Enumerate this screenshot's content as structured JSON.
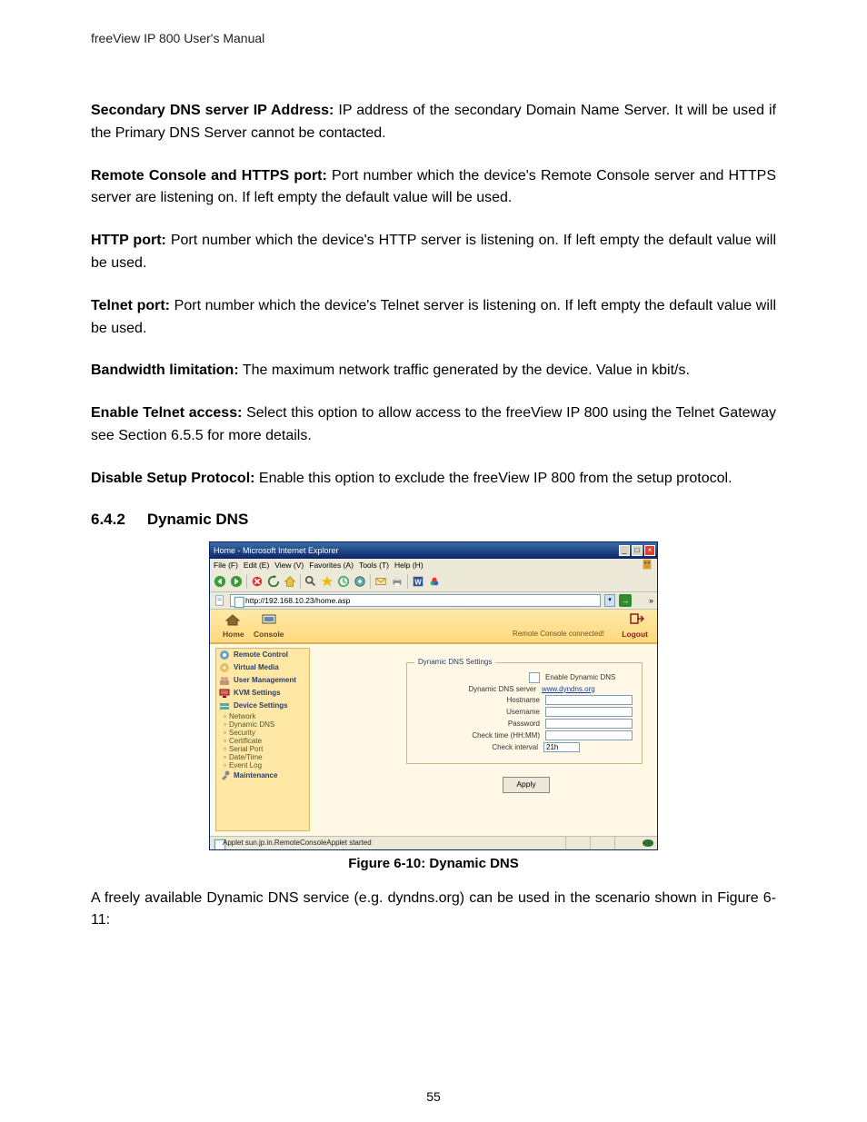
{
  "header_text": "freeView IP 800 User's Manual",
  "page_number": "55",
  "defs": {
    "secdns": {
      "label": "Secondary DNS server IP Address:",
      "text": "  IP address of the secondary Domain Name Server. It will be used if the Primary DNS Server cannot be contacted."
    },
    "rcport": {
      "label": "Remote Console and HTTPS port:",
      "text": " Port number which the device's Remote Console server and HTTPS server are listening on. If left empty the default value will be used."
    },
    "httpport": {
      "label": "HTTP port:",
      "text": " Port number which the device's HTTP server is listening on. If left empty the default value will be used."
    },
    "telnetport": {
      "label": "Telnet port:",
      "text": " Port number which the device's Telnet server is listening on. If left empty the default value will be used."
    },
    "bandwidth": {
      "label": "Bandwidth limitation:",
      "text": " The maximum network traffic generated by the device. Value in kbit/s."
    },
    "telnetacc": {
      "label": "Enable Telnet access:",
      "text": " Select this option to allow access to the freeView IP 800 using the Telnet Gateway see Section 6.5.5 for more details."
    },
    "disablesetup": {
      "label": "Disable Setup Protocol:",
      "text": " Enable this option to exclude the freeView IP 800 from the setup protocol."
    }
  },
  "section": {
    "num": "6.4.2",
    "title": "Dynamic DNS"
  },
  "figure_caption": "Figure 6-10: Dynamic DNS",
  "post_figure_text": "A freely available Dynamic DNS service (e.g. dyndns.org) can be used in the scenario shown in Figure 6-11:",
  "screenshot": {
    "window_title": "Home - Microsoft Internet Explorer",
    "menu": {
      "file": "File",
      "edit": "Edit",
      "view": "View",
      "favorites": "Favorites",
      "tools": "Tools",
      "help": "Help"
    },
    "address_url": "http://192.168.10.23/home.asp",
    "app_header": {
      "home": "Home",
      "console": "Console",
      "status": "Remote Console connected!",
      "logout": "Logout"
    },
    "sidebar": {
      "remote_control": "Remote Control",
      "virtual_media": "Virtual Media",
      "user_management": "User Management",
      "kvm_settings": "KVM Settings",
      "device_settings": "Device Settings",
      "sub": {
        "network": "Network",
        "dynamic_dns": "Dynamic DNS",
        "security": "Security",
        "certificate": "Certificate",
        "serial_port": "Serial Port",
        "date_time": "Date/Time",
        "event_log": "Event Log"
      },
      "maintenance": "Maintenance"
    },
    "form": {
      "legend": "Dynamic DNS Settings",
      "enable_label": "Enable Dynamic DNS",
      "server_label": "Dynamic DNS server",
      "server_value": "www.dyndns.org",
      "hostname_label": "Hostname",
      "username_label": "Username",
      "password_label": "Password",
      "checktime_label": "Check time (HH:MM)",
      "checkinterval_label": "Check interval",
      "checkinterval_value": "21h",
      "apply": "Apply"
    },
    "statusbar_text": "Applet sun.jp.in.RemoteConsoleApplet started"
  }
}
